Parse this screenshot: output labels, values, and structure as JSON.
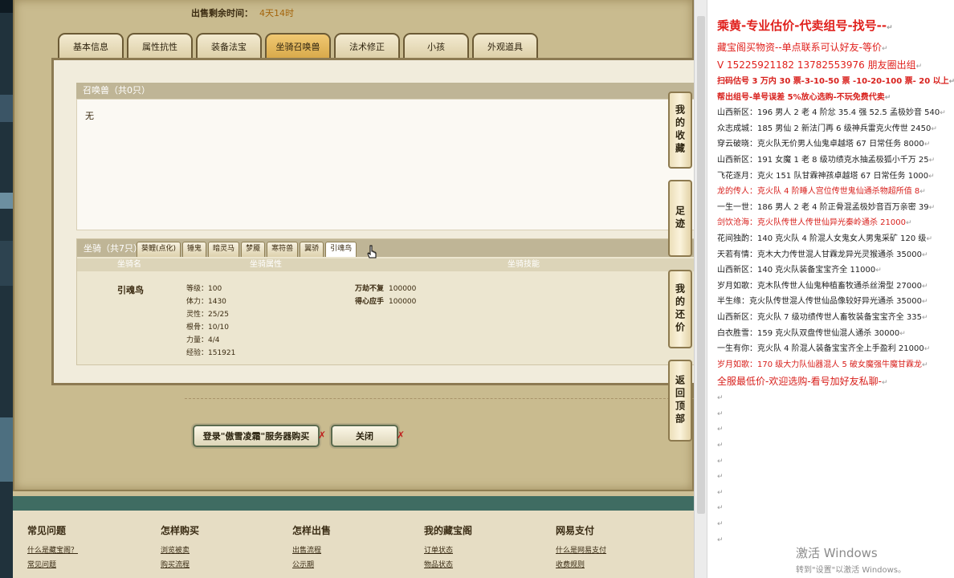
{
  "game": {
    "sale_time_label": "出售剩余时间：",
    "sale_time_value": "4天14时",
    "tabs": [
      "基本信息",
      "属性抗性",
      "装备法宝",
      "坐骑召唤兽",
      "法术修正",
      "小孩",
      "外观道具"
    ],
    "active_tab": "坐骑召唤兽",
    "summon": {
      "header": "召唤兽（共0只）",
      "empty": "无"
    },
    "mount": {
      "header": "坐骑（共7只）",
      "tabs": [
        "葵鲤(点化)",
        "锤鬼",
        "暗灵马",
        "梦魇",
        "寒符兽",
        "翼骄",
        "引魂鸟"
      ],
      "active_tab": "引魂鸟",
      "columns": [
        "坐骑名",
        "坐骑属性",
        "坐骑技能"
      ],
      "name": "引魂鸟",
      "stats": [
        "等级：100",
        "体力：1430",
        "灵性：25/25",
        "根骨：10/10",
        "力量：4/4",
        "经验：151921"
      ],
      "skills": [
        {
          "name": "万劫不复",
          "value": "100000"
        },
        {
          "name": "得心应手",
          "value": "100000"
        }
      ]
    },
    "buttons": {
      "login": "登录\"傲雪凌霜\"服务器购买",
      "close": "关闭"
    },
    "side_rail": [
      "我的收藏",
      "足迹",
      "我的还价",
      "返回顶部"
    ],
    "footer": [
      {
        "title": "常见问题",
        "links": [
          "什么是藏宝阁？",
          "常见问题"
        ]
      },
      {
        "title": "怎样购买",
        "links": [
          "浏览被卖",
          "购买流程"
        ]
      },
      {
        "title": "怎样出售",
        "links": [
          "出售流程",
          "公示期"
        ]
      },
      {
        "title": "我的藏宝阁",
        "links": [
          "订单状态",
          "物品状态"
        ]
      },
      {
        "title": "网易支付",
        "links": [
          "什么是网易支付",
          "收费规则"
        ]
      }
    ]
  },
  "doc": {
    "lines": [
      {
        "style": "title",
        "text": "乘黄-专业估价-代卖组号-找号--"
      },
      {
        "style": "subred",
        "text": "藏宝阁买物资--单点联系可认好友-等价"
      },
      {
        "style": "subred",
        "text": "V 15225921182   13782553976 朋友圈出组"
      },
      {
        "style": "redb",
        "text": "扫码估号 3 万内 30 票-3-10-50 票  -10-20-100 票- 20 以上"
      },
      {
        "style": "redb",
        "text": "帮出组号-单号误差 5%放心选购-不玩免费代卖"
      },
      {
        "style": "normal",
        "text": "山西新区：196 男人 2 老 4 阶忿 35.4 强 52.5 孟极妙音 540"
      },
      {
        "style": "normal",
        "text": "众志成城：185 男仙 2 新法门再 6 级神兵雷克火传世 2450"
      },
      {
        "style": "normal",
        "text": "穿云破晓：克火队无价男人仙鬼卓越塔 67 日常任务 8000"
      },
      {
        "style": "normal",
        "text": "山西新区：191 女魔 1 老 8 级功绩克水抽孟极狐小千万 25"
      },
      {
        "style": "normal",
        "text": "飞花逐月：克火 151 队甘霖神孩卓越塔 67 日常任务 1000"
      },
      {
        "style": "red",
        "text": "龙的传人：克火队 4 阶睡人宫位传世鬼仙通杀物超所值 8"
      },
      {
        "style": "normal",
        "text": "一生一世：186 男人 2 老 4 阶正骨混孟极妙音百万亲密 39"
      },
      {
        "style": "red",
        "text": "剑饮沧海：克火队传世人传世仙异光秦岭通杀 21000"
      },
      {
        "style": "normal",
        "text": "花间独酌：140 克火队 4 阶混人女鬼女人男鬼采矿 120 级"
      },
      {
        "style": "normal",
        "text": "天若有情：克木大力传世混人甘霖龙异光灵猴通杀 35000"
      },
      {
        "style": "normal",
        "text": "山西新区：140 克火队装备宝宝齐全 11000"
      },
      {
        "style": "normal",
        "text": "岁月如歌：克木队传世人仙鬼种植畜牧通杀丝滑型 27000"
      },
      {
        "style": "normal",
        "text": "半生缘：克火队传世混人传世仙品像较好异光通杀 35000"
      },
      {
        "style": "normal",
        "text": "山西新区：克火队 7 级功绩传世人畜牧装备宝宝齐全 335"
      },
      {
        "style": "normal",
        "text": "白衣胜雪：159 克火队双盘传世仙混人通杀 30000"
      },
      {
        "style": "normal",
        "text": "一生有你：克火队 4 阶混人装备宝宝齐全上手盈利 21000"
      },
      {
        "style": "red",
        "text": "岁月如歌：170 级大力队仙器混人 5 破女魔强牛魔甘霖龙"
      },
      {
        "style": "big",
        "text": "全服最低价-欢迎选购-看号加好友私聊-"
      },
      {
        "style": "normal",
        "text": ""
      },
      {
        "style": "normal",
        "text": ""
      },
      {
        "style": "normal",
        "text": ""
      },
      {
        "style": "normal",
        "text": ""
      },
      {
        "style": "normal",
        "text": ""
      },
      {
        "style": "normal",
        "text": ""
      },
      {
        "style": "normal",
        "text": ""
      },
      {
        "style": "normal",
        "text": ""
      },
      {
        "style": "normal",
        "text": ""
      },
      {
        "style": "normal",
        "text": ""
      }
    ],
    "watermark_title": "激活 Windows",
    "watermark_sub": "转到\"设置\"以激活 Windows。"
  },
  "colors": {
    "accent_red": "#d8201c",
    "tab_active": "#e2b458",
    "footer_bar": "#3f6c62"
  }
}
